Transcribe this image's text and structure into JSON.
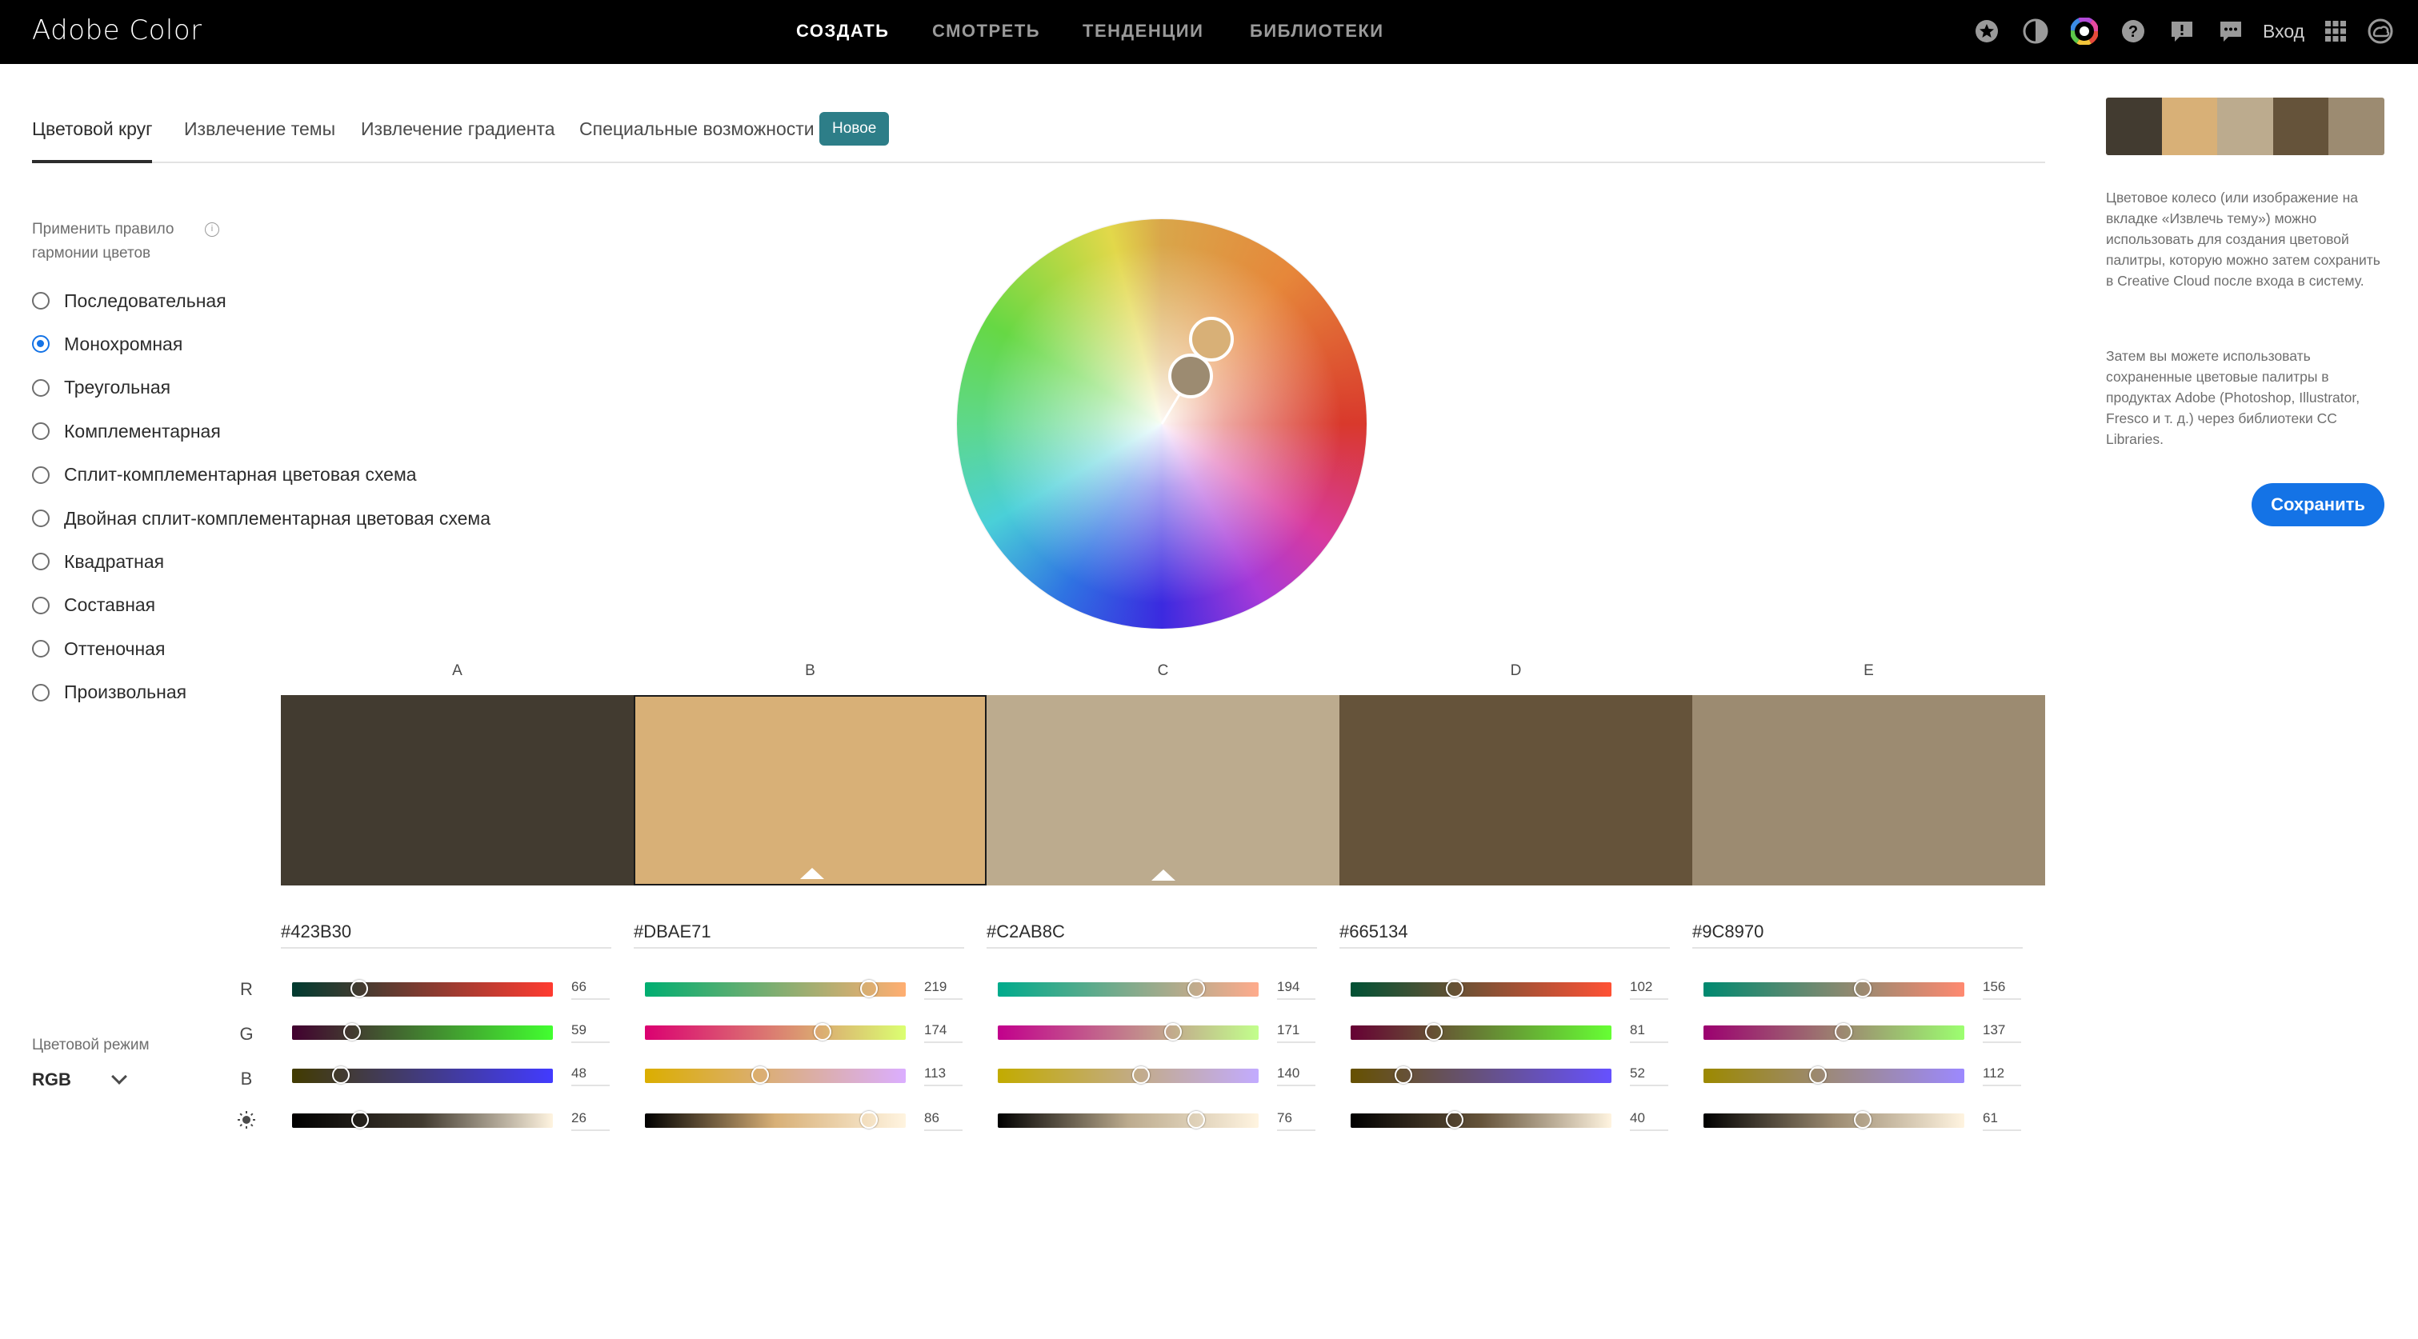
{
  "app": {
    "title": "Adobe Color"
  },
  "topnav": {
    "items": [
      {
        "label": "СОЗДАТЬ",
        "active": true
      },
      {
        "label": "СМОТРЕТЬ",
        "active": false
      },
      {
        "label": "ТЕНДЕНЦИИ",
        "active": false
      },
      {
        "label": "БИБЛИОТЕКИ",
        "active": false
      }
    ],
    "icons": [
      "star-icon",
      "contrast-icon",
      "color-wheel-icon",
      "help-icon",
      "feedback-icon",
      "chat-icon",
      "apps-grid-icon",
      "creative-cloud-icon"
    ],
    "signin_label": "Вход"
  },
  "tabs": {
    "items": [
      {
        "label": "Цветовой круг",
        "active": true
      },
      {
        "label": "Извлечение темы",
        "active": false
      },
      {
        "label": "Извлечение градиента",
        "active": false
      },
      {
        "label": "Специальные возможности",
        "active": false
      }
    ],
    "badge": "Новое"
  },
  "harmony": {
    "label": "Применить правило гармонии цветов",
    "info_icon": "info-icon",
    "options": [
      {
        "label": "Последовательная",
        "checked": false
      },
      {
        "label": "Монохромная",
        "checked": true
      },
      {
        "label": "Треугольная",
        "checked": false
      },
      {
        "label": "Комплементарная",
        "checked": false
      },
      {
        "label": "Сплит-комплементарная цветовая схема",
        "checked": false
      },
      {
        "label": "Двойная сплит-комплементарная цветовая схема",
        "checked": false
      },
      {
        "label": "Квадратная",
        "checked": false
      },
      {
        "label": "Составная",
        "checked": false
      },
      {
        "label": "Оттеночная",
        "checked": false
      },
      {
        "label": "Произвольная",
        "checked": false
      }
    ]
  },
  "color_mode": {
    "label": "Цветовой режим",
    "value": "RGB"
  },
  "channels": [
    "R",
    "G",
    "B"
  ],
  "brightness_icon": "brightness-icon",
  "swatches": [
    {
      "letter": "A",
      "hex": "#423B30",
      "color": "#423b30",
      "selected": false,
      "marker": false,
      "r": 66,
      "g": 59,
      "b": 48,
      "bright": 26
    },
    {
      "letter": "B",
      "hex": "#DBAE71",
      "color": "#d8b077",
      "selected": true,
      "marker": true,
      "r": 219,
      "g": 174,
      "b": 113,
      "bright": 86
    },
    {
      "letter": "C",
      "hex": "#C2AB8C",
      "color": "#bcab8e",
      "selected": false,
      "marker": true,
      "r": 194,
      "g": 171,
      "b": 140,
      "bright": 76
    },
    {
      "letter": "D",
      "hex": "#665134",
      "color": "#65533a",
      "selected": false,
      "marker": false,
      "r": 102,
      "g": 81,
      "b": 52,
      "bright": 40
    },
    {
      "letter": "E",
      "hex": "#9C8970",
      "color": "#9c8b71",
      "selected": false,
      "marker": false,
      "r": 156,
      "g": 137,
      "b": 112,
      "bright": 61
    }
  ],
  "sidebar": {
    "palette": [
      "#423b30",
      "#d8b077",
      "#bcab8e",
      "#65533a",
      "#9c8b71"
    ],
    "desc1": "Цветовое колесо (или изображение на вкладке «Извлечь тему») можно использовать для создания цветовой палитры, которую можно затем сохранить в Creative Cloud после входа в систему.",
    "desc2": "Затем вы можете использовать сохраненные цветовые палитры в продуктах Adobe (Photoshop, Illustrator, Fresco и т. д.) через библиотеки CC Libraries.",
    "save_label": "Сохранить"
  },
  "colors": {
    "accent": "#1473e6",
    "badge": "#2d7e88",
    "topbar": "#000000"
  }
}
